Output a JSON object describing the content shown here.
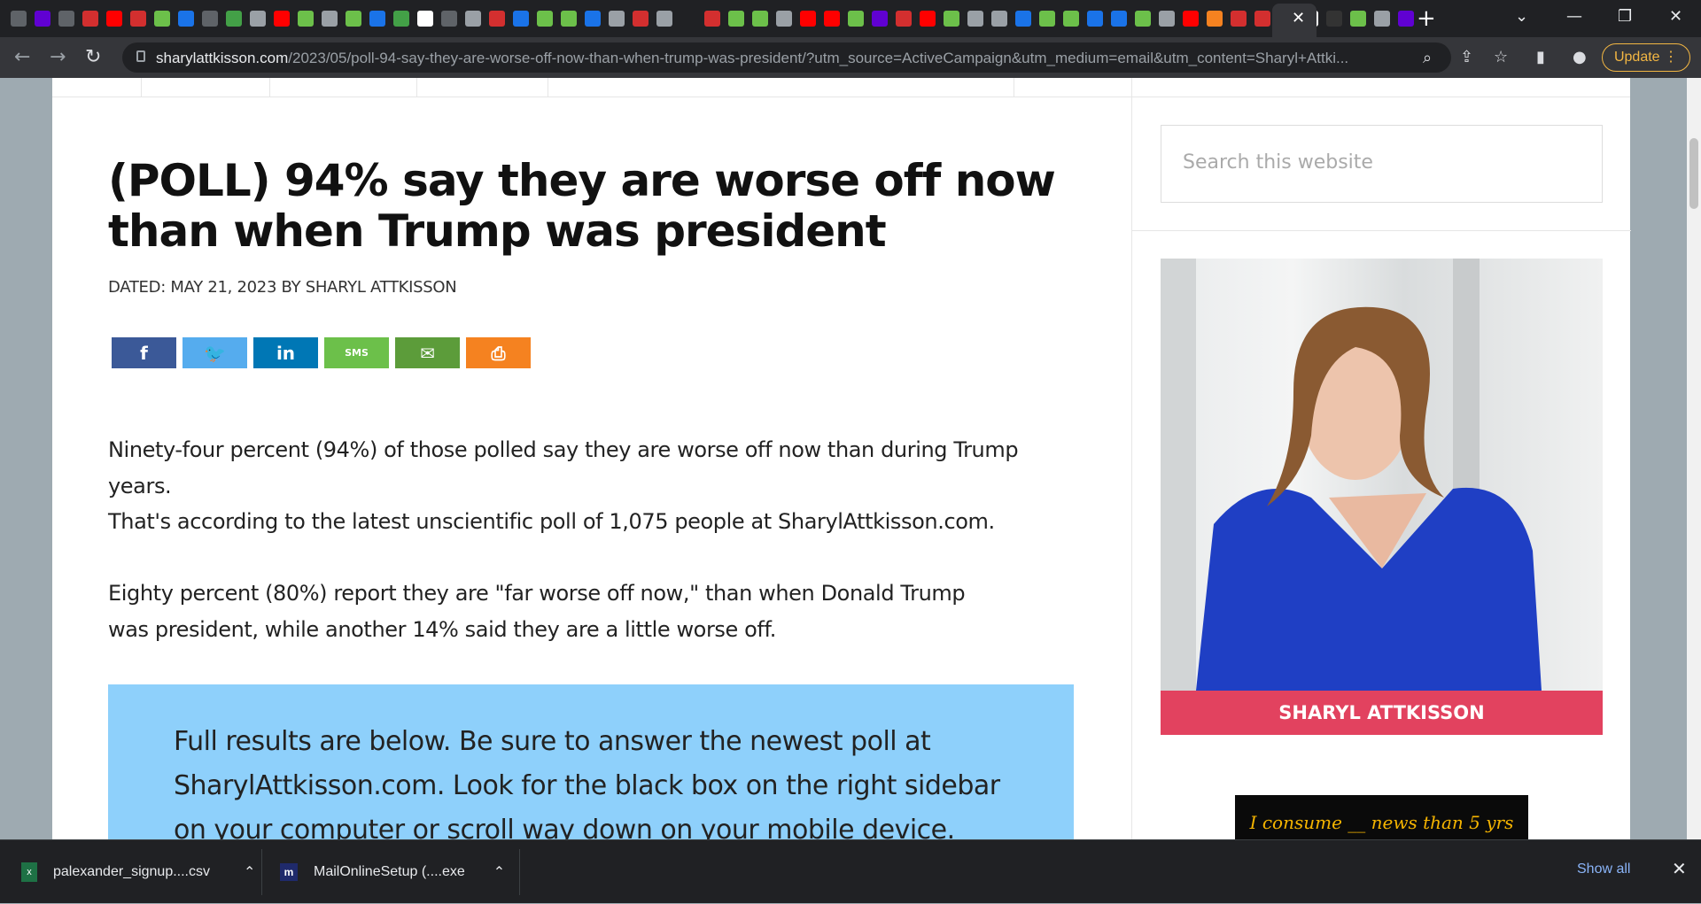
{
  "browser": {
    "url_host": "sharylattkisson.com",
    "url_path": "/2023/05/poll-94-say-they-are-worse-off-now-than-when-trump-was-president/?utm_source=ActiveCampaign&utm_medium=email&utm_content=Sharyl+Attki...",
    "update_label": "Update",
    "tab_close": "✕",
    "new_tab": "+"
  },
  "article": {
    "title": "(POLL) 94% say they are worse off now than when Trump was president",
    "meta": "DATED: MAY 21, 2023 BY SHARYL ATTKISSON",
    "paragraphs": [
      "Ninety-four percent (94%) of those polled say they are worse off now than during Trump years.",
      "That's according to the latest unscientific poll of 1,075 people at SharylAttkisson.com.",
      "Eighty percent (80%) report they are \"far worse off now,\" than when Donald Trump was president, while another 14% said they are a little worse off."
    ],
    "callout": "Full results are below. Be sure to answer the newest poll at SharylAttkisson.com. Look for the black box on the right sidebar on your computer or scroll way down on your mobile device."
  },
  "share": {
    "facebook": "f",
    "twitter": "🐦",
    "linkedin": "in",
    "sms": "SMS",
    "email": "✉",
    "print": "⎙"
  },
  "sidebar": {
    "search_placeholder": "Search this website",
    "name": "SHARYL ATTKISSON",
    "poll_box": "I consume __ news than 5 yrs"
  },
  "downloads": {
    "items": [
      "palexander_signup....csv",
      "MailOnlineSetup (....exe"
    ],
    "show_all": "Show all"
  },
  "colors": {
    "facebook": "#3b5998",
    "twitter": "#55acee",
    "linkedin": "#0077b5",
    "sms": "#6cc04a",
    "email": "#5c9c3a",
    "print": "#f58220",
    "callout": "#8ed0fb",
    "name_bar": "#e2425f"
  }
}
